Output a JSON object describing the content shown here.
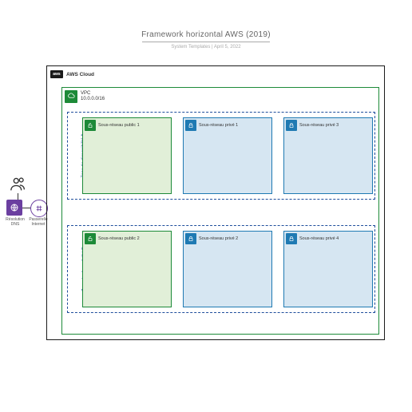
{
  "header": {
    "title": "Framework horizontal AWS (2019)",
    "subtitle": "System Templates  |  April 5, 2022"
  },
  "aws": {
    "logo": "aws",
    "label": "AWS Cloud"
  },
  "vpc": {
    "label": "VPC",
    "cidr": "10.0.0.0/16"
  },
  "az_a": {
    "label": "Zone de disponibilité A"
  },
  "az_b": {
    "label": "Zone de disponibilité B"
  },
  "subnets": {
    "pub1": "Sous-réseau public 1",
    "priv1": "Sous-réseau privé 1",
    "priv3": "Sous-réseau privé 3",
    "pub2": "Sous-réseau public 2",
    "priv2": "Sous-réseau privé 2",
    "priv4": "Sous-réseau privé 4"
  },
  "external": {
    "dns": "Résolution DNS",
    "igw": "Passerelle Internet"
  }
}
